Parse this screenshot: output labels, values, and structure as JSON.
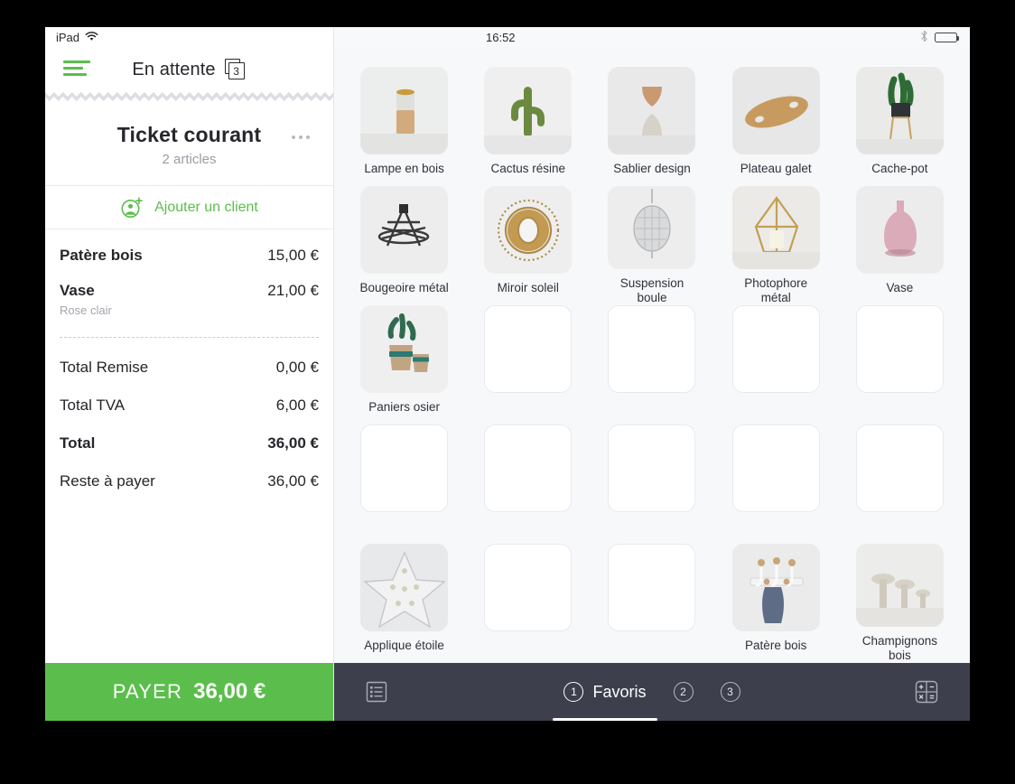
{
  "status_bar_left": {
    "device": "iPad",
    "wifi_icon": "wifi-icon"
  },
  "status_bar_right": {
    "time": "16:52",
    "bluetooth_icon": "bluetooth-icon",
    "battery_icon": "battery-icon"
  },
  "ticket_panel": {
    "menu_icon": "hamburger-menu-icon",
    "pending_label": "En attente",
    "pending_count": "3",
    "title": "Ticket courant",
    "subtitle": "2 articles",
    "more_icon": "more-options-icon",
    "add_client": {
      "icon": "add-client-icon",
      "label": "Ajouter un client"
    },
    "items": [
      {
        "name": "Patère bois",
        "variant": "",
        "price": "15,00 €"
      },
      {
        "name": "Vase",
        "variant": "Rose clair",
        "price": "21,00 €"
      }
    ],
    "totals": [
      {
        "label": "Total Remise",
        "value": "0,00 €",
        "bold": false
      },
      {
        "label": "Total TVA",
        "value": "6,00 €",
        "bold": false
      },
      {
        "label": "Total",
        "value": "36,00 €",
        "bold": true
      },
      {
        "label": "Reste à payer",
        "value": "36,00 €",
        "bold": false
      }
    ],
    "pay_button": {
      "label": "PAYER",
      "amount": "36,00 €",
      "color": "#5BBE4C"
    }
  },
  "products": [
    {
      "label": "Lampe en bois",
      "empty": false,
      "art": "lamp"
    },
    {
      "label": "Cactus résine",
      "empty": false,
      "art": "cactus"
    },
    {
      "label": "Sablier design",
      "empty": false,
      "art": "hourglass"
    },
    {
      "label": "Plateau galet",
      "empty": false,
      "art": "tray"
    },
    {
      "label": "Cache-pot",
      "empty": false,
      "art": "cachepot"
    },
    {
      "label": "Bougeoire métal",
      "empty": false,
      "art": "candle"
    },
    {
      "label": "Miroir soleil",
      "empty": false,
      "art": "mirror"
    },
    {
      "label": "Suspension boule",
      "empty": false,
      "art": "pendant"
    },
    {
      "label": "Photophore métal",
      "empty": false,
      "art": "lantern"
    },
    {
      "label": "Vase",
      "empty": false,
      "art": "vase"
    },
    {
      "label": "Paniers osier",
      "empty": false,
      "art": "baskets"
    },
    {
      "label": "",
      "empty": true,
      "art": ""
    },
    {
      "label": "",
      "empty": true,
      "art": ""
    },
    {
      "label": "",
      "empty": true,
      "art": ""
    },
    {
      "label": "",
      "empty": true,
      "art": ""
    },
    {
      "label": "",
      "empty": true,
      "art": ""
    },
    {
      "label": "",
      "empty": true,
      "art": ""
    },
    {
      "label": "",
      "empty": true,
      "art": ""
    },
    {
      "label": "",
      "empty": true,
      "art": ""
    },
    {
      "label": "",
      "empty": true,
      "art": ""
    },
    {
      "label": "Applique étoile",
      "empty": false,
      "art": "star"
    },
    {
      "label": "",
      "empty": true,
      "art": ""
    },
    {
      "label": "",
      "empty": true,
      "art": ""
    },
    {
      "label": "Patère bois",
      "empty": false,
      "art": "hooks"
    },
    {
      "label": "Champignons bois",
      "empty": false,
      "art": "mushrooms"
    }
  ],
  "tabbar": {
    "list_icon": "list-view-icon",
    "calculator_icon": "calculator-icon",
    "tabs": [
      {
        "num": "1",
        "label": "Favoris",
        "active": true
      },
      {
        "num": "2",
        "label": "",
        "active": false
      },
      {
        "num": "3",
        "label": "",
        "active": false
      }
    ],
    "background_color": "#3d3f4c"
  }
}
